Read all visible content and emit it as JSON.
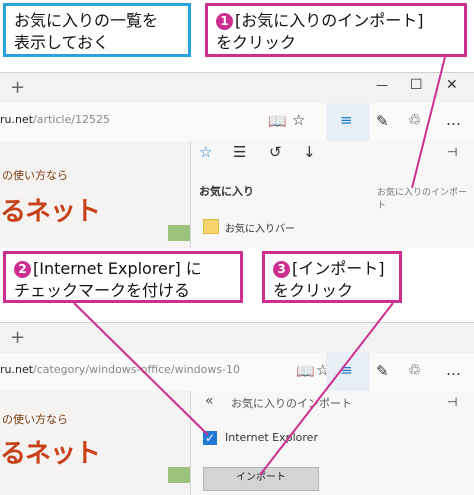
{
  "callouts": {
    "intro": {
      "line1": "お気に入りの一覧を",
      "line2": "表示しておく"
    },
    "step1": {
      "number": "❶",
      "line1": "[お気に入りのインポート]",
      "line2": "をクリック"
    },
    "step2": {
      "number": "❷",
      "line1": "[Internet Explorer] に",
      "line2": "チェックマークを付ける"
    },
    "step3": {
      "number": "❸",
      "line1": "[インポート]",
      "line2": "をクリック"
    }
  },
  "window1": {
    "new_tab": "+",
    "minimize": "—",
    "maximize": "☐",
    "close": "✕",
    "url_host": "ru.net",
    "url_path": "/article/12525",
    "site_subtitle": "の使い方なら",
    "site_logo": "るネット",
    "hub_tabs": [
      "☆",
      "☰",
      "↺",
      "↓"
    ],
    "pin": "⊣",
    "panel_title": "お気に入り",
    "import_link": "お気に入りのインポート",
    "favorites_bar": "お気に入りバー"
  },
  "window2": {
    "new_tab": "+",
    "url_host": "ru.net",
    "url_path": "/category/windows-office/windows-10",
    "site_subtitle": "の使い方なら",
    "site_logo": "るネット",
    "back": "«",
    "panel_title": "お気に入りのインポート",
    "pin": "⊣",
    "ie_option": "Internet Explorer",
    "import_button": "インポート"
  },
  "colors": {
    "pink": "#cc2f8f",
    "blue": "#29a3e0",
    "accent": "#1e78d4"
  }
}
